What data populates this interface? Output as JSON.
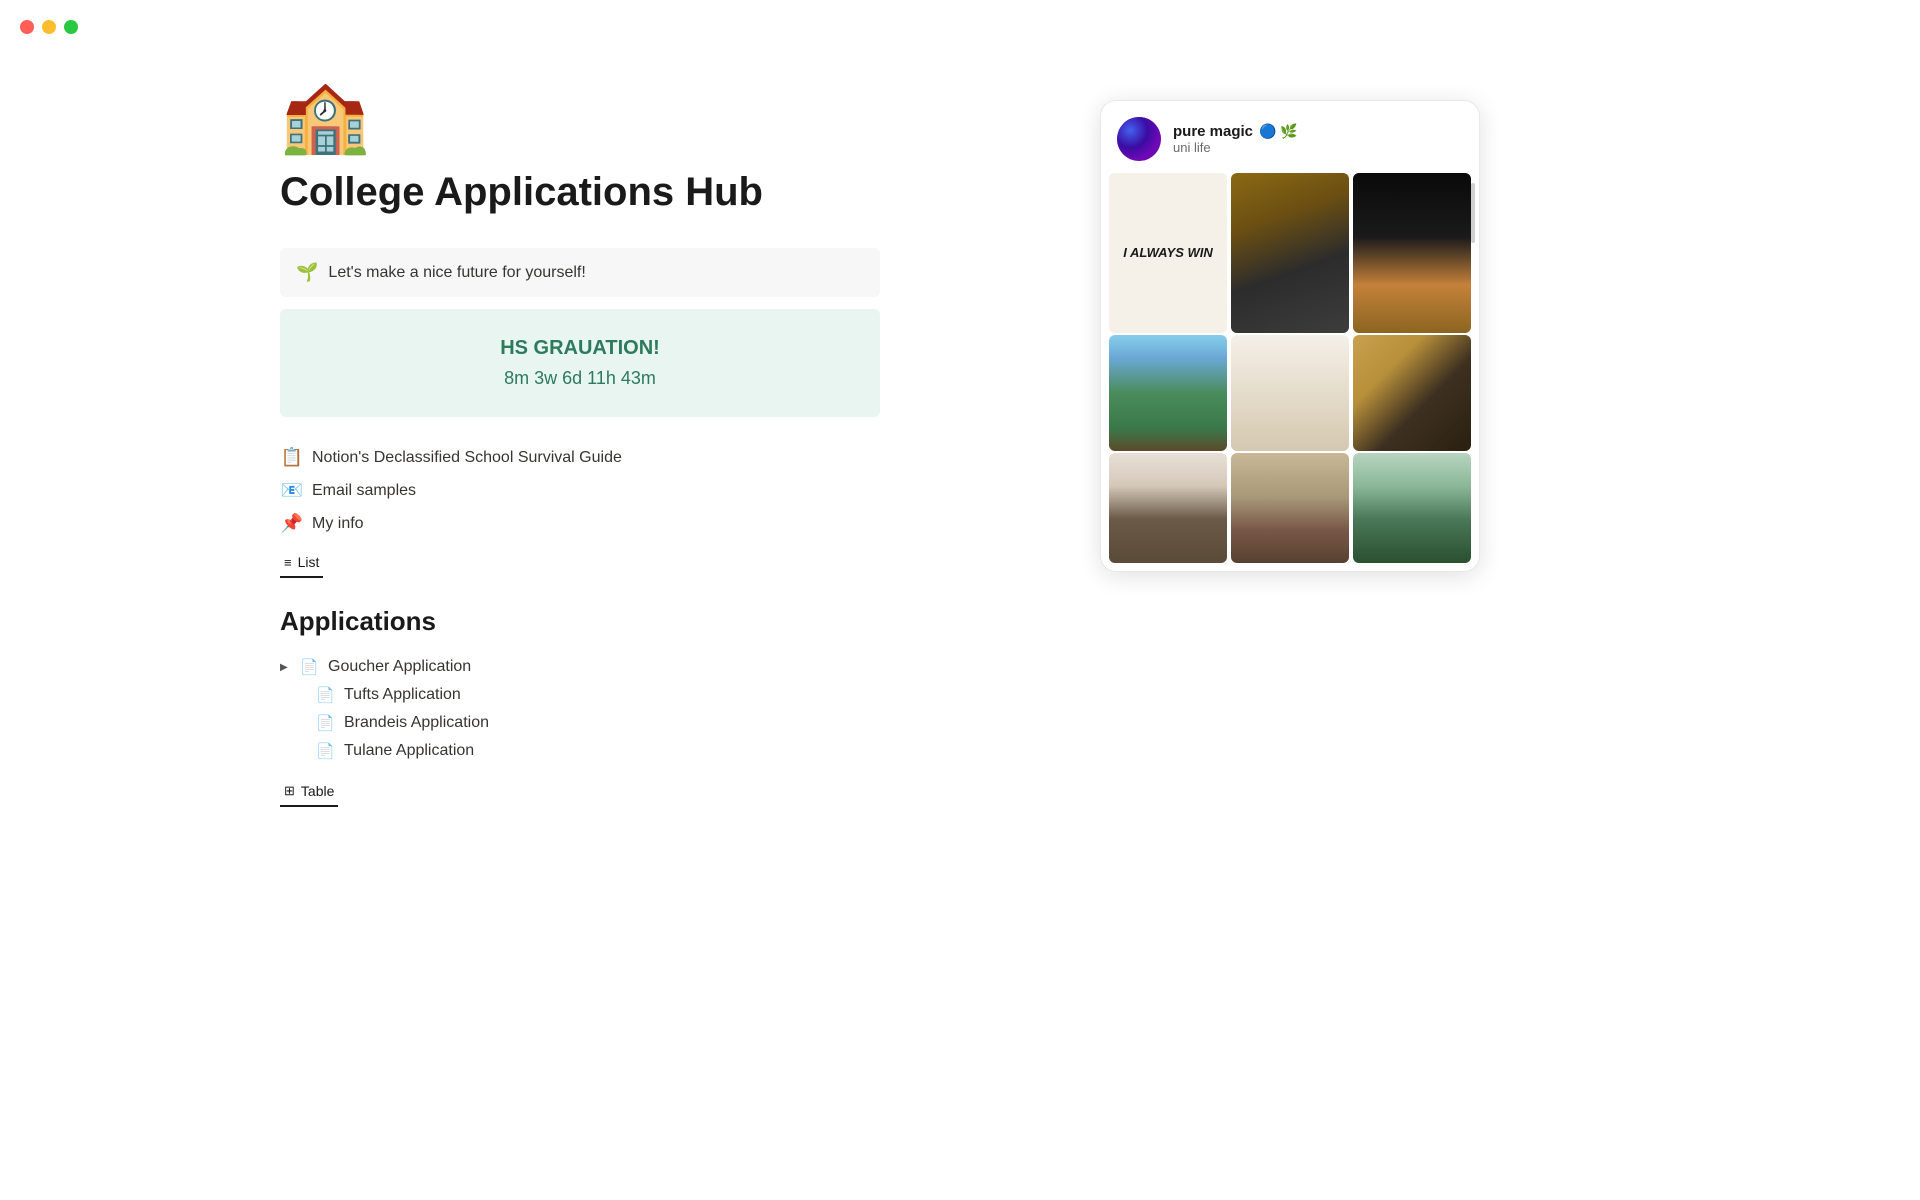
{
  "window": {
    "title": "College Applications Hub"
  },
  "traffic_lights": {
    "red_label": "close",
    "yellow_label": "minimize",
    "green_label": "maximize"
  },
  "page": {
    "icon": "🏫",
    "title": "College Applications Hub"
  },
  "callout": {
    "icon": "🌱",
    "text": "Let's make a nice future for yourself!"
  },
  "countdown": {
    "title": "HS GRAUATION!",
    "time": "8m 3w 6d 11h 43m"
  },
  "links": [
    {
      "icon": "📋",
      "text": "Notion's Declassified School Survival Guide"
    },
    {
      "icon": "📧",
      "text": "Email samples"
    },
    {
      "icon": "📌",
      "text": "My info"
    }
  ],
  "list_tab": {
    "icon": "≡",
    "label": "List"
  },
  "applications_section": {
    "title": "Applications",
    "items": [
      {
        "name": "Goucher Application",
        "has_arrow": true,
        "indented": false
      },
      {
        "name": "Tufts Application",
        "has_arrow": false,
        "indented": true
      },
      {
        "name": "Brandeis Application",
        "has_arrow": false,
        "indented": true
      },
      {
        "name": "Tulane Application",
        "has_arrow": false,
        "indented": true
      }
    ]
  },
  "table_tab": {
    "icon": "⊞",
    "label": "Table"
  },
  "pinterest_card": {
    "username": "pure magic",
    "badges": "🔵 🌿",
    "subtitle": "uni life",
    "text_cell": "I ALWAYS WIN"
  }
}
